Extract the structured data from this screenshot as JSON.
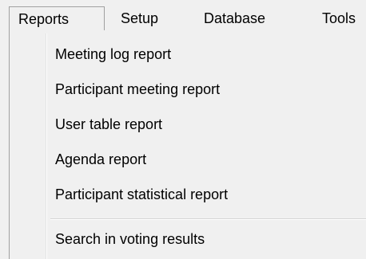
{
  "menubar": {
    "items": [
      {
        "label": "Reports"
      },
      {
        "label": "Setup"
      },
      {
        "label": "Database"
      },
      {
        "label": "Tools"
      }
    ]
  },
  "reports_menu": {
    "items": [
      {
        "label": "Meeting log report"
      },
      {
        "label": "Participant meeting report"
      },
      {
        "label": "User table report"
      },
      {
        "label": "Agenda report"
      },
      {
        "label": "Participant statistical report"
      },
      {
        "label": "Search in voting results"
      }
    ]
  }
}
